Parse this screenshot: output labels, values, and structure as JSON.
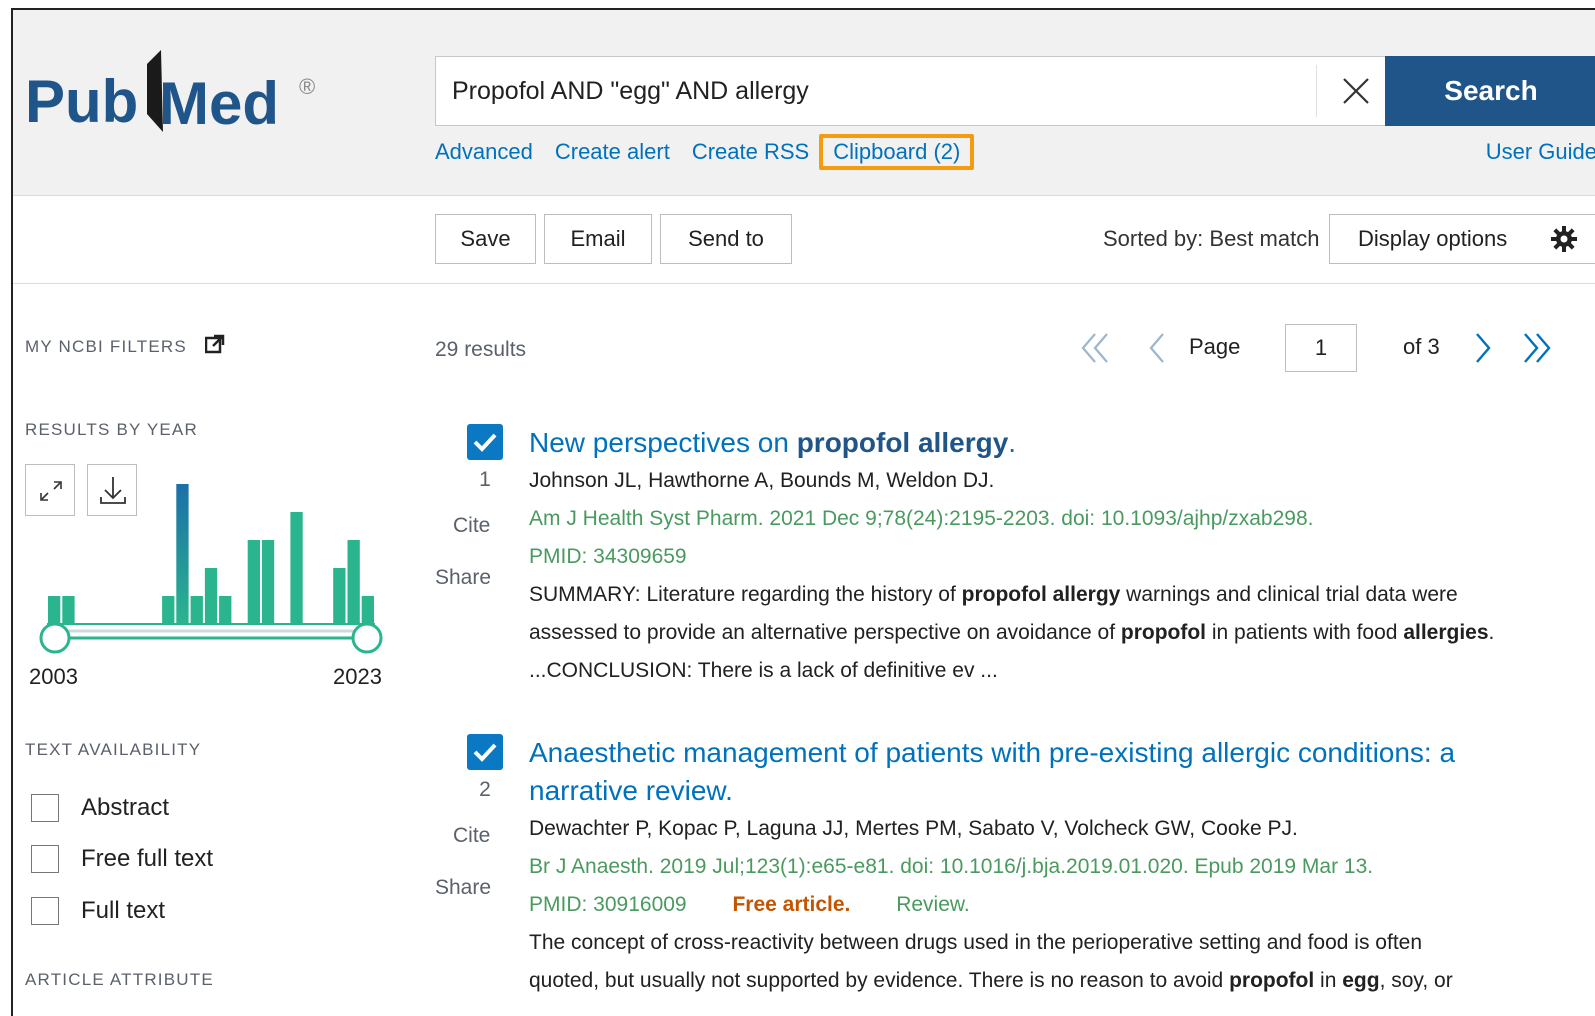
{
  "logo": {
    "text_pub": "Pub",
    "text_med": "Med",
    "registered": "®"
  },
  "search": {
    "value": "Propofol AND \"egg\" AND allergy",
    "button_label": "Search"
  },
  "header_links": {
    "advanced": "Advanced",
    "create_alert": "Create alert",
    "create_rss": "Create RSS",
    "clipboard": "Clipboard (2)",
    "user_guide": "User Guide"
  },
  "toolbar": {
    "save": "Save",
    "email": "Email",
    "send_to": "Send to",
    "sorted_by": "Sorted by: Best match",
    "display_options": "Display options"
  },
  "sidebar": {
    "my_ncbi_filters": "MY NCBI FILTERS",
    "results_by_year": "RESULTS BY YEAR",
    "year_start": "2003",
    "year_end": "2023",
    "text_availability": "TEXT AVAILABILITY",
    "filters": [
      {
        "label": "Abstract",
        "checked": false
      },
      {
        "label": "Free full text",
        "checked": false
      },
      {
        "label": "Full text",
        "checked": false
      }
    ],
    "article_attribute": "ARTICLE ATTRIBUTE",
    "histogram": {
      "bar_color": "#2bb58e",
      "highlight_color": "#1b6fa8",
      "values": [
        1,
        1,
        0,
        0,
        0,
        0,
        0,
        0,
        1,
        5,
        1,
        2,
        1,
        0,
        3,
        3,
        0,
        4,
        0,
        0,
        2,
        3,
        1
      ]
    }
  },
  "results_count": "29 results",
  "pagination": {
    "page_label": "Page",
    "current": "1",
    "of_label": "of 3"
  },
  "results": [
    {
      "number": "1",
      "checked": true,
      "title_plain": "New perspectives on ",
      "title_bold": "propofol allergy",
      "title_end": ".",
      "authors": "Johnson JL, Hawthorne A, Bounds M, Weldon DJ.",
      "citation": "Am J Health Syst Pharm. 2021 Dec 9;78(24):2195-2203. doi: 10.1093/ajhp/zxab298.",
      "pmid": "PMID: 34309659",
      "snippet_1a": "SUMMARY: Literature regarding the history of ",
      "snippet_1b": "propofol allergy",
      "snippet_1c": " warnings and clinical trial data were",
      "snippet_2a": "assessed to provide an alternative perspective on avoidance of ",
      "snippet_2b": "propofol",
      "snippet_2c": " in patients with food ",
      "snippet_2d": "allergies",
      "snippet_2e": ".",
      "snippet_3": "...CONCLUSION: There is a lack of definitive ev ...",
      "cite": "Cite",
      "share": "Share"
    },
    {
      "number": "2",
      "checked": true,
      "title_line1": "Anaesthetic management of patients with pre-existing allergic conditions: a",
      "title_line2": "narrative review.",
      "authors": "Dewachter P, Kopac P, Laguna JJ, Mertes PM, Sabato V, Volcheck GW, Cooke PJ.",
      "citation": "Br J Anaesth. 2019 Jul;123(1):e65-e81. doi: 10.1016/j.bja.2019.01.020. Epub 2019 Mar 13.",
      "pmid": "PMID: 30916009",
      "free": "Free article.",
      "review": "Review.",
      "snippet_1": "The concept of cross-reactivity between drugs used in the perioperative setting and food is often",
      "snippet_2a": "quoted, but usually not supported by evidence. There is no reason to avoid ",
      "snippet_2b": "propofol",
      "snippet_2c": " in ",
      "snippet_2d": "egg",
      "snippet_2e": ", soy, or",
      "cite": "Cite",
      "share": "Share"
    }
  ]
}
